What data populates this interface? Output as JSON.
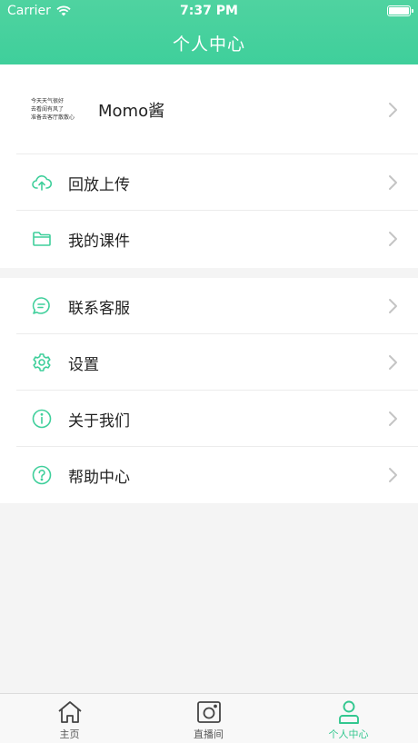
{
  "status_bar": {
    "carrier": "Carrier",
    "time": "7:37 PM"
  },
  "nav": {
    "title": "个人中心"
  },
  "profile": {
    "avatar_lines": [
      "今天天气很好",
      "去看闺有风了",
      "准备去客厅散散心"
    ],
    "name": "Momo酱"
  },
  "menu_group_1": [
    {
      "label": "回放上传",
      "icon": "cloud-upload-icon"
    },
    {
      "label": "我的课件",
      "icon": "folder-icon"
    }
  ],
  "menu_group_2": [
    {
      "label": "联系客服",
      "icon": "chat-bubble-icon"
    },
    {
      "label": "设置",
      "icon": "gear-icon"
    },
    {
      "label": "关于我们",
      "icon": "info-icon"
    },
    {
      "label": "帮助中心",
      "icon": "help-icon"
    }
  ],
  "tabbar": {
    "tabs": [
      {
        "label": "主页",
        "icon": "home-icon"
      },
      {
        "label": "直播间",
        "icon": "camera-icon"
      },
      {
        "label": "个人中心",
        "icon": "person-icon"
      }
    ],
    "active_index": 2
  },
  "colors": {
    "accent": "#3fcf9b",
    "chevron": "#c4c4c4",
    "background": "#f4f4f4"
  }
}
